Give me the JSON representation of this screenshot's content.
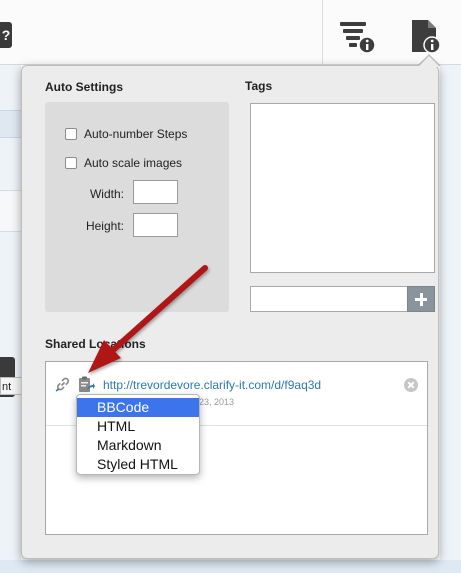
{
  "background": {
    "left_icon_text": "?",
    "side_tag_text": "nt"
  },
  "toolbar_icons": [
    "list-info-icon",
    "document-info-icon"
  ],
  "auto_settings": {
    "title": "Auto Settings",
    "auto_number_label": "Auto-number Steps",
    "auto_number_checked": false,
    "auto_scale_label": "Auto scale images",
    "auto_scale_checked": false,
    "width_label": "Width:",
    "width_value": "",
    "height_label": "Height:",
    "height_value": ""
  },
  "tags": {
    "title": "Tags",
    "new_tag_value": "",
    "add_icon": "plus-icon"
  },
  "shared": {
    "title": "Shared Locations",
    "items": [
      {
        "url": "http://trevordevore.clarify-it.com/d/f9aq3d",
        "date": "23, 2013"
      }
    ]
  },
  "format_menu": {
    "items": [
      "BBCode",
      "HTML",
      "Markdown",
      "Styled HTML"
    ],
    "selected": "BBCode"
  },
  "colors": {
    "accent": "#3c74ec",
    "link": "#2a78b8",
    "arrow": "#b01818",
    "add_button": "#8a949c"
  }
}
